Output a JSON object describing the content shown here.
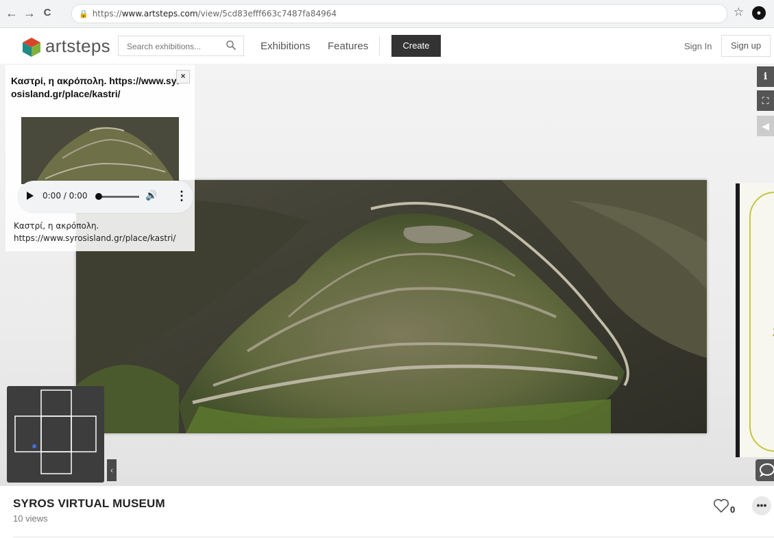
{
  "browser": {
    "url_prefix": "https://",
    "url_host": "www.artsteps.com",
    "url_path": "/view/5cd83efff663c7487fa84964",
    "back_glyph": "←",
    "forward_glyph": "→",
    "reload_glyph": "C",
    "star_glyph": "☆",
    "extension_glyph": "❶"
  },
  "header": {
    "logo_text": "artsteps",
    "search_placeholder": "Search exhibitions...",
    "nav": [
      "Exhibitions",
      "Features"
    ],
    "create_label": "Create",
    "signin_label": "Sign In",
    "signup_label": "Sign up"
  },
  "viewer": {
    "side_buttons": [
      {
        "icon": "info-icon",
        "glyph": "i"
      },
      {
        "icon": "fullscreen-icon",
        "glyph": "⛶"
      },
      {
        "icon": "sound-icon",
        "glyph": "◀"
      }
    ],
    "right_frame_letter": "λ",
    "collapse_glyph": "‹",
    "popup": {
      "title": "Καστρί, η ακρόπολη. https://www.syrosisland.gr/place/kastri/",
      "close_glyph": "×",
      "audio_time": "0:00 / 0:00",
      "audio_volume_glyph": "🔊",
      "audio_more_glyph": "⋮",
      "description_line1": "Καστρί, η ακρόπολη.",
      "description_line2": "https://www.syrosisland.gr/place/kastri/"
    }
  },
  "exhibition": {
    "title": "SYROS VIRTUAL MUSEUM",
    "views_count": "10",
    "views_label": "views",
    "likes": "0",
    "more_glyph": "•••"
  },
  "colors": {
    "accent_dark": "#333333",
    "logo_red": "#d9452b",
    "logo_teal": "#1e8c85",
    "logo_green": "#7fb13d",
    "frame_yellow": "#c6c63a"
  }
}
